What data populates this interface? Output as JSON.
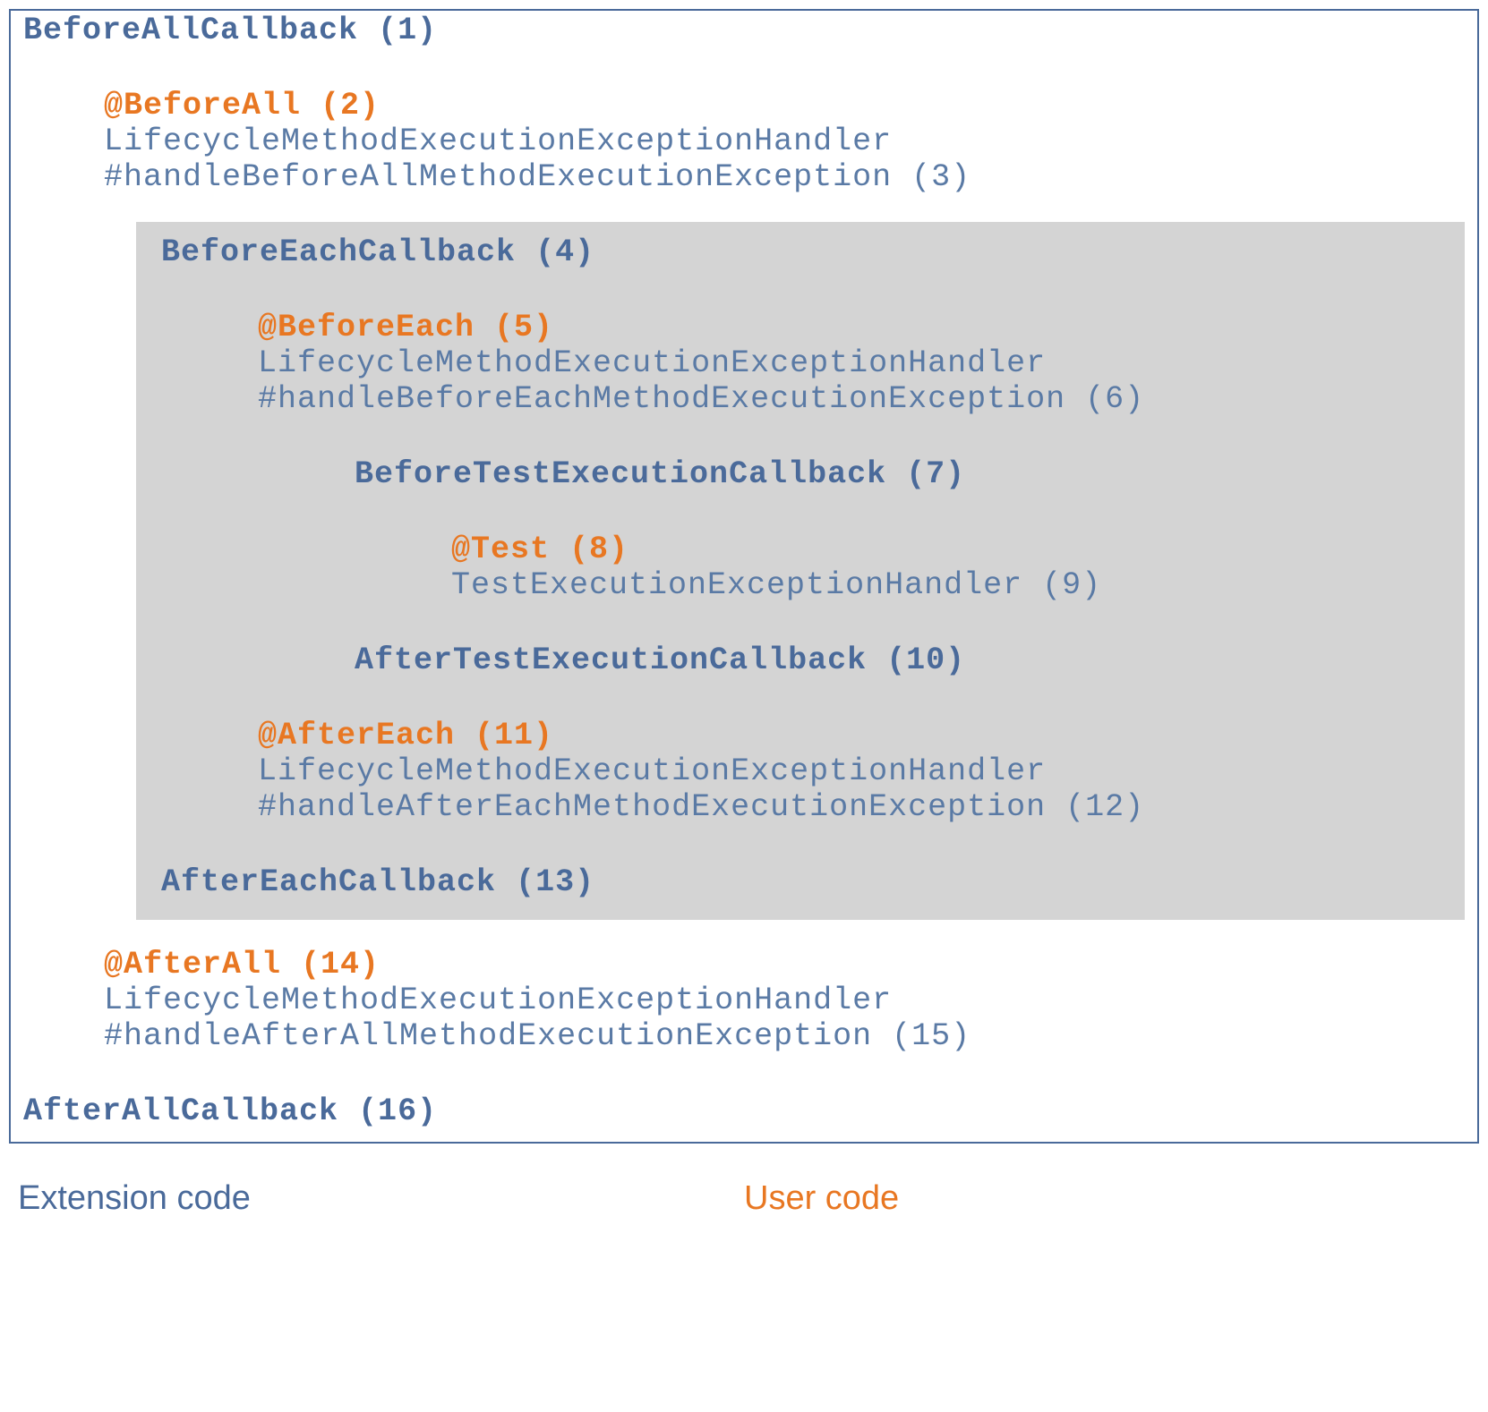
{
  "lines": {
    "l1": "BeforeAllCallback (1)",
    "l2": "@BeforeAll (2)",
    "l3a": "LifecycleMethodExecutionExceptionHandler",
    "l3b": "#handleBeforeAllMethodExecutionException (3)",
    "l4": "BeforeEachCallback (4)",
    "l5": "@BeforeEach (5)",
    "l6a": "LifecycleMethodExecutionExceptionHandler",
    "l6b": "#handleBeforeEachMethodExecutionException (6)",
    "l7": "BeforeTestExecutionCallback (7)",
    "l8": "@Test (8)",
    "l9": "TestExecutionExceptionHandler (9)",
    "l10": "AfterTestExecutionCallback (10)",
    "l11": "@AfterEach (11)",
    "l12a": "LifecycleMethodExecutionExceptionHandler",
    "l12b": "#handleAfterEachMethodExecutionException (12)",
    "l13": "AfterEachCallback (13)",
    "l14": "@AfterAll (14)",
    "l15a": "LifecycleMethodExecutionExceptionHandler",
    "l15b": "#handleAfterAllMethodExecutionException (15)",
    "l16": "AfterAllCallback (16)"
  },
  "legend": {
    "ext": "Extension code",
    "user": "User code"
  },
  "chart_data": {
    "type": "diagram",
    "title": "JUnit 5 Extension Lifecycle Callback Order",
    "legend": [
      {
        "name": "Extension code",
        "color": "#4a6a9a"
      },
      {
        "name": "User code",
        "color": "#e87722"
      }
    ],
    "steps": [
      {
        "order": 1,
        "name": "BeforeAllCallback",
        "type": "extension",
        "level": 0
      },
      {
        "order": 2,
        "name": "@BeforeAll",
        "type": "user",
        "level": 1
      },
      {
        "order": 3,
        "name": "LifecycleMethodExecutionExceptionHandler#handleBeforeAllMethodExecutionException",
        "type": "extension",
        "level": 1
      },
      {
        "order": 4,
        "name": "BeforeEachCallback",
        "type": "extension",
        "level": 2
      },
      {
        "order": 5,
        "name": "@BeforeEach",
        "type": "user",
        "level": 3
      },
      {
        "order": 6,
        "name": "LifecycleMethodExecutionExceptionHandler#handleBeforeEachMethodExecutionException",
        "type": "extension",
        "level": 3
      },
      {
        "order": 7,
        "name": "BeforeTestExecutionCallback",
        "type": "extension",
        "level": 4
      },
      {
        "order": 8,
        "name": "@Test",
        "type": "user",
        "level": 5
      },
      {
        "order": 9,
        "name": "TestExecutionExceptionHandler",
        "type": "extension",
        "level": 5
      },
      {
        "order": 10,
        "name": "AfterTestExecutionCallback",
        "type": "extension",
        "level": 4
      },
      {
        "order": 11,
        "name": "@AfterEach",
        "type": "user",
        "level": 3
      },
      {
        "order": 12,
        "name": "LifecycleMethodExecutionExceptionHandler#handleAfterEachMethodExecutionException",
        "type": "extension",
        "level": 3
      },
      {
        "order": 13,
        "name": "AfterEachCallback",
        "type": "extension",
        "level": 2
      },
      {
        "order": 14,
        "name": "@AfterAll",
        "type": "user",
        "level": 1
      },
      {
        "order": 15,
        "name": "LifecycleMethodExecutionExceptionHandler#handleAfterAllMethodExecutionException",
        "type": "extension",
        "level": 1
      },
      {
        "order": 16,
        "name": "AfterAllCallback",
        "type": "extension",
        "level": 0
      }
    ]
  }
}
